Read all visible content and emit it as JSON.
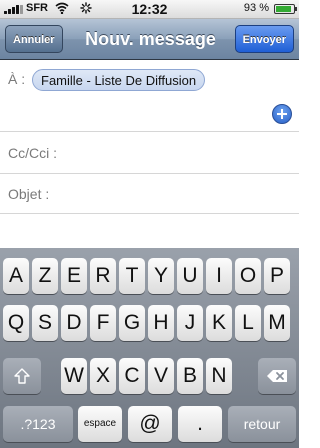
{
  "status_bar": {
    "carrier": "SFR",
    "time": "12:32",
    "battery_percent_label": "93 %",
    "battery_level": 0.93
  },
  "nav": {
    "cancel_label": "Annuler",
    "title": "Nouv. message",
    "send_label": "Envoyer"
  },
  "form": {
    "to_label": "À :",
    "to_recipient": "Famille - Liste De Diffusion",
    "cc_label": "Cc/Cci :",
    "subject_label": "Objet :"
  },
  "keyboard": {
    "row1": [
      "A",
      "Z",
      "E",
      "R",
      "T",
      "Y",
      "U",
      "I",
      "O",
      "P"
    ],
    "row2": [
      "Q",
      "S",
      "D",
      "F",
      "G",
      "H",
      "J",
      "K",
      "L",
      "M"
    ],
    "row3": [
      "W",
      "X",
      "C",
      "V",
      "B",
      "N"
    ],
    "numbers_label": ".?123",
    "space_label": "espace",
    "at_label": "@",
    "dot_label": ".",
    "return_label": "retour"
  },
  "colors": {
    "nav_bar": "#7d93ad",
    "send_button": "#2a6bdd",
    "token_border": "#8fa7d3"
  }
}
